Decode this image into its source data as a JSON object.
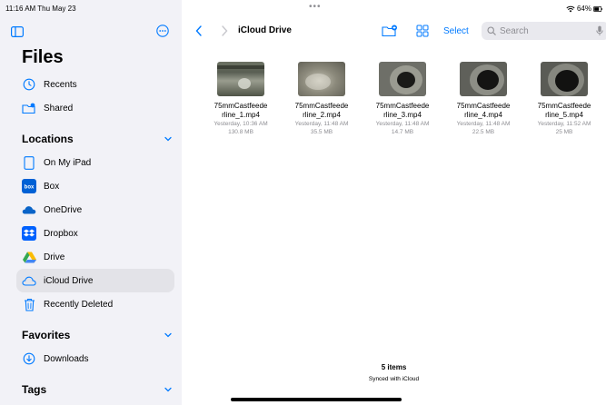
{
  "status": {
    "time_date": "11:16 AM  Thu May 23",
    "dots": "•••",
    "battery": "64%"
  },
  "sidebar": {
    "title": "Files",
    "top_items": [
      {
        "label": "Recents",
        "icon": "clock-icon"
      },
      {
        "label": "Shared",
        "icon": "shared-folder-icon"
      }
    ],
    "locations_header": "Locations",
    "locations": [
      {
        "label": "On My iPad",
        "icon": "ipad-icon"
      },
      {
        "label": "Box",
        "icon": "box-icon"
      },
      {
        "label": "OneDrive",
        "icon": "onedrive-cloud-icon"
      },
      {
        "label": "Dropbox",
        "icon": "dropbox-icon"
      },
      {
        "label": "Drive",
        "icon": "google-drive-icon"
      },
      {
        "label": "iCloud Drive",
        "icon": "icloud-icon",
        "selected": true
      },
      {
        "label": "Recently Deleted",
        "icon": "trash-icon"
      }
    ],
    "favorites_header": "Favorites",
    "favorites": [
      {
        "label": "Downloads",
        "icon": "download-circle-icon"
      }
    ],
    "tags_header": "Tags"
  },
  "toolbar": {
    "folder_title": "iCloud Drive",
    "select_label": "Select",
    "search_placeholder": "Search"
  },
  "files": [
    {
      "name_line1": "75mmCastfeede",
      "name_line2": "rline_1.mp4",
      "date": "Yesterday, 10:36 AM",
      "size": "130.8 MB"
    },
    {
      "name_line1": "75mmCastfeede",
      "name_line2": "rline_2.mp4",
      "date": "Yesterday, 11:48 AM",
      "size": "35.5 MB"
    },
    {
      "name_line1": "75mmCastfeede",
      "name_line2": "rline_3.mp4",
      "date": "Yesterday, 11:48 AM",
      "size": "14.7 MB"
    },
    {
      "name_line1": "75mmCastfeede",
      "name_line2": "rline_4.mp4",
      "date": "Yesterday, 11:48 AM",
      "size": "22.5 MB"
    },
    {
      "name_line1": "75mmCastfeede",
      "name_line2": "rline_5.mp4",
      "date": "Yesterday, 11:52 AM",
      "size": "25 MB"
    }
  ],
  "footer": {
    "count": "5 items",
    "sync": "Synced with iCloud"
  },
  "colors": {
    "accent": "#007aff",
    "sidebar_bg": "#f2f2f7",
    "selected_bg": "#e3e3e8"
  }
}
